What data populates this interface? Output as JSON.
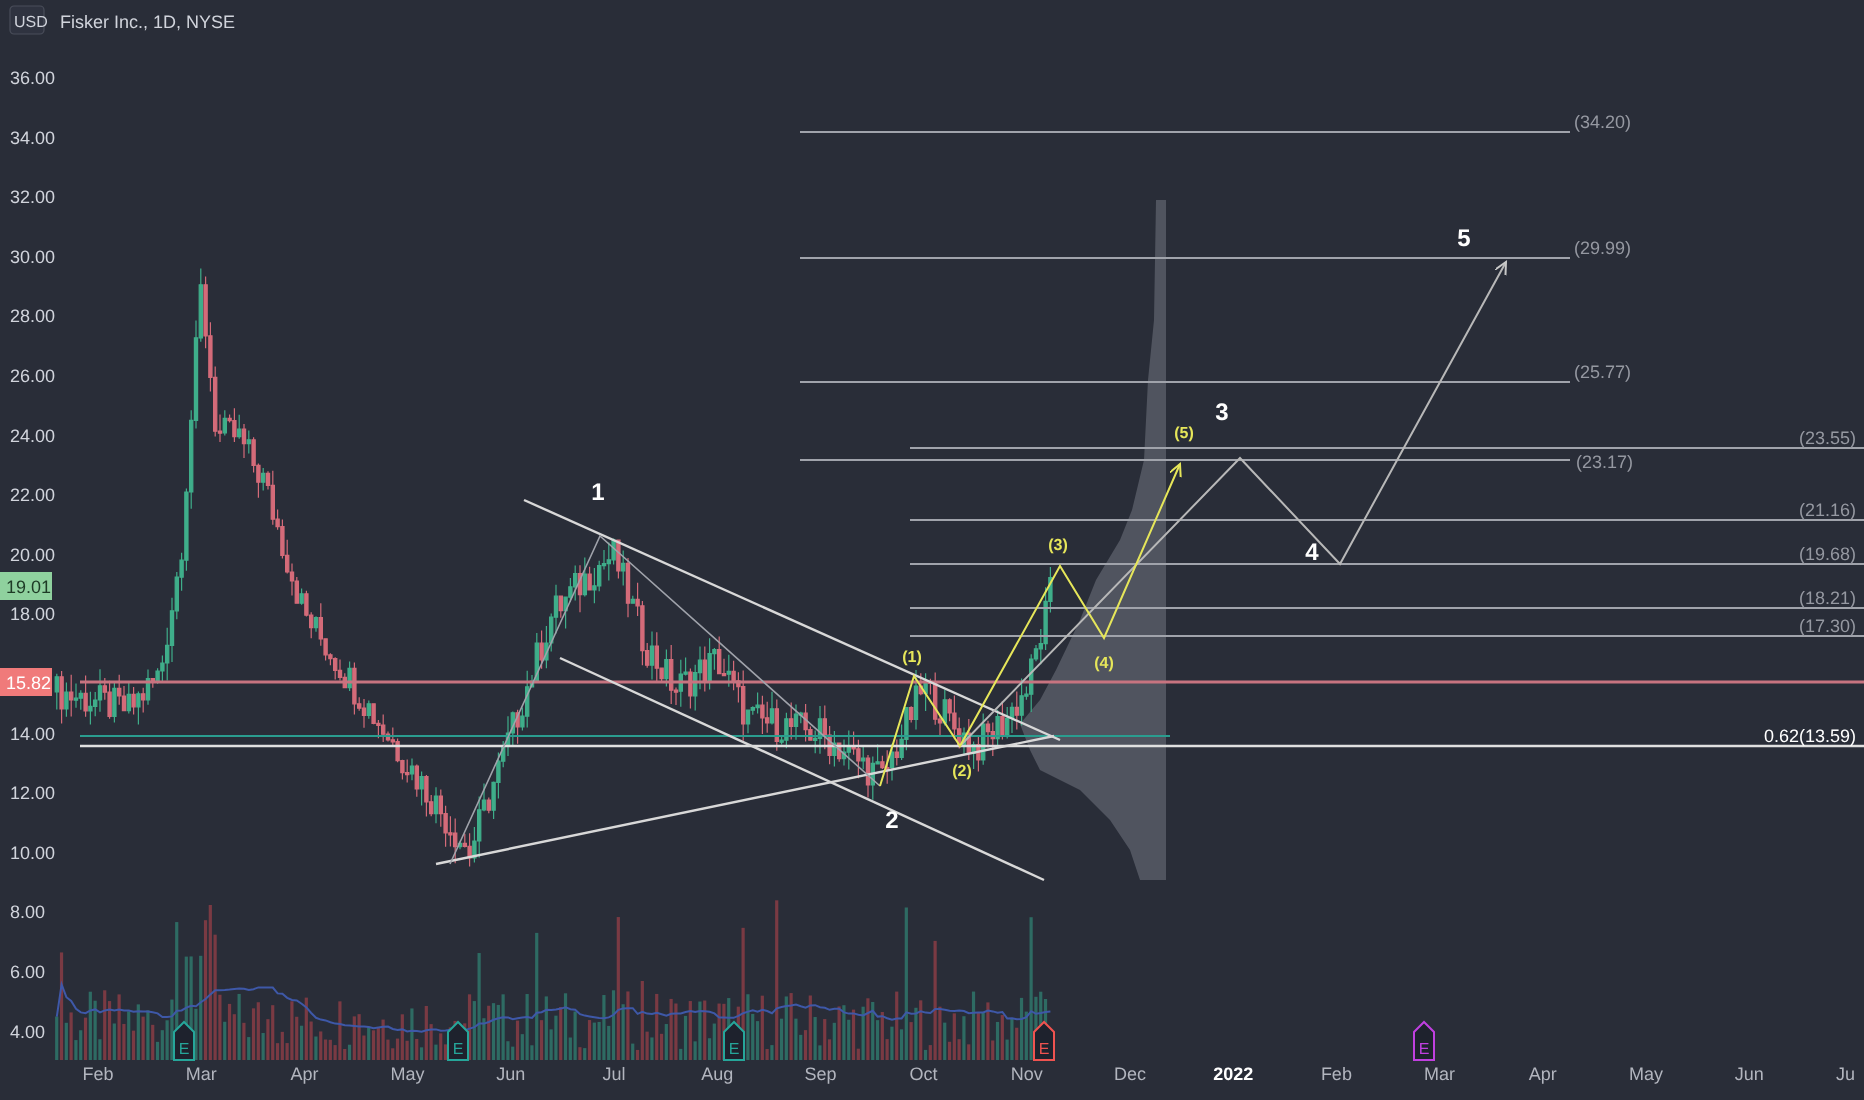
{
  "header": {
    "currency": "USD",
    "title": "Fisker Inc., 1D, NYSE"
  },
  "price_axis": {
    "ticks": [
      "36.00",
      "34.00",
      "32.00",
      "30.00",
      "28.00",
      "26.00",
      "24.00",
      "22.00",
      "20.00",
      "18.00",
      "14.00",
      "12.00",
      "10.00",
      "8.00",
      "6.00",
      "4.00"
    ]
  },
  "price_badges": [
    {
      "label": "19.01",
      "color": "#8fd19e"
    },
    {
      "label": "15.82",
      "color": "#f07a7a"
    }
  ],
  "time_axis": [
    {
      "label": "Feb",
      "bold": false
    },
    {
      "label": "Mar",
      "bold": false
    },
    {
      "label": "Apr",
      "bold": false
    },
    {
      "label": "May",
      "bold": false
    },
    {
      "label": "Jun",
      "bold": false
    },
    {
      "label": "Jul",
      "bold": false
    },
    {
      "label": "Aug",
      "bold": false
    },
    {
      "label": "Sep",
      "bold": false
    },
    {
      "label": "Oct",
      "bold": false
    },
    {
      "label": "Nov",
      "bold": false
    },
    {
      "label": "Dec",
      "bold": false
    },
    {
      "label": "2022",
      "bold": true
    },
    {
      "label": "Feb",
      "bold": false
    },
    {
      "label": "Mar",
      "bold": false
    },
    {
      "label": "Apr",
      "bold": false
    },
    {
      "label": "May",
      "bold": false
    },
    {
      "label": "Jun",
      "bold": false
    },
    {
      "label": "Ju",
      "bold": false
    }
  ],
  "fib_levels": [
    {
      "label": "(34.20)"
    },
    {
      "label": "(29.99)"
    },
    {
      "label": "(25.77)"
    },
    {
      "label": "(23.17)"
    },
    {
      "label": "(23.55)"
    },
    {
      "label": "(21.16)"
    },
    {
      "label": "(19.68)"
    },
    {
      "label": "(18.21)"
    },
    {
      "label": "(17.30)"
    },
    {
      "label": "0.62(13.59)"
    }
  ],
  "wave_labels": [
    {
      "label": "1"
    },
    {
      "label": "2"
    },
    {
      "label": "3"
    },
    {
      "label": "4"
    },
    {
      "label": "5"
    }
  ],
  "subwave_labels": [
    {
      "label": "(1)"
    },
    {
      "label": "(2)"
    },
    {
      "label": "(3)"
    },
    {
      "label": "(4)"
    },
    {
      "label": "(5)"
    }
  ],
  "earnings_markers": [
    {
      "label": "E",
      "color": "#26a69a"
    },
    {
      "label": "E",
      "color": "#26a69a"
    },
    {
      "label": "E",
      "color": "#26a69a"
    },
    {
      "label": "E",
      "color": "#ef5350"
    },
    {
      "label": "E",
      "color": "#c040e0"
    }
  ]
}
